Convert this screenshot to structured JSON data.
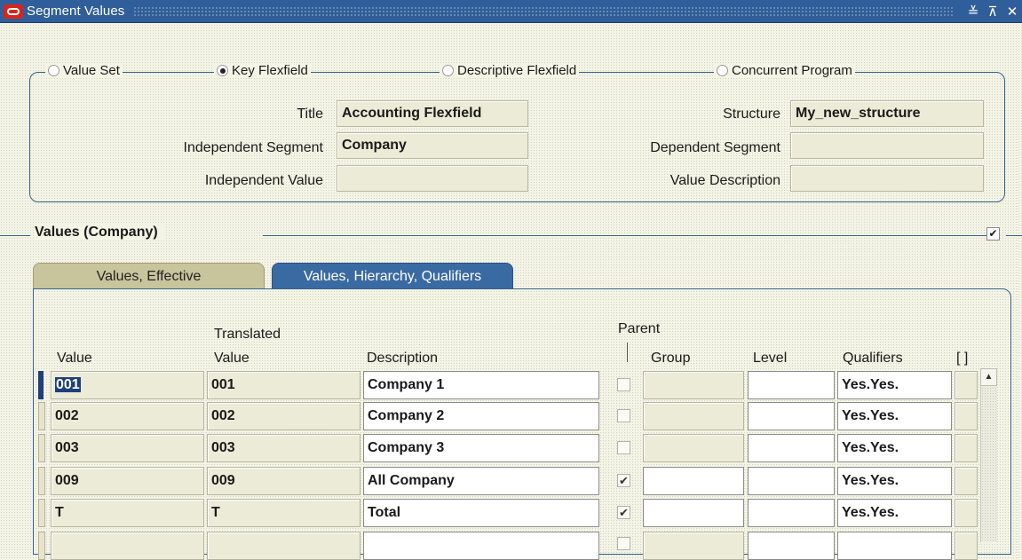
{
  "window": {
    "title": "Segment Values",
    "buttons": [
      "≚",
      "⊼",
      "✕"
    ]
  },
  "query_options": [
    {
      "label": "Value Set",
      "selected": false
    },
    {
      "label": "Key Flexfield",
      "selected": true
    },
    {
      "label": "Descriptive Flexfield",
      "selected": false
    },
    {
      "label": "Concurrent Program",
      "selected": false
    }
  ],
  "form": {
    "title_label": "Title",
    "title_value": "Accounting Flexfield",
    "structure_label": "Structure",
    "structure_value": "My_new_structure",
    "independent_segment_label": "Independent Segment",
    "independent_segment_value": "Company",
    "dependent_segment_label": "Dependent Segment",
    "dependent_segment_value": "",
    "independent_value_label": "Independent Value",
    "independent_value_value": "",
    "value_description_label": "Value Description",
    "value_description_value": ""
  },
  "section": {
    "title": "Values (Company)",
    "checked": true
  },
  "tabs": [
    {
      "label": "Values, Effective",
      "active": false
    },
    {
      "label": "Values, Hierarchy, Qualifiers",
      "active": true
    }
  ],
  "table": {
    "headers": {
      "value": "Value",
      "translated_top": "Translated",
      "translated_bottom": "Value",
      "description": "Description",
      "parent": "Parent",
      "group": "Group",
      "level": "Level",
      "qualifiers": "Qualifiers",
      "dff": "[ ]"
    },
    "rows": [
      {
        "value": "001",
        "translated": "001",
        "description": "Company 1",
        "parent": false,
        "group": "",
        "level": "",
        "qualifiers": "Yes.Yes."
      },
      {
        "value": "002",
        "translated": "002",
        "description": "Company 2",
        "parent": false,
        "group": "",
        "level": "",
        "qualifiers": "Yes.Yes."
      },
      {
        "value": "003",
        "translated": "003",
        "description": "Company 3",
        "parent": false,
        "group": "",
        "level": "",
        "qualifiers": "Yes.Yes."
      },
      {
        "value": "009",
        "translated": "009",
        "description": "All Company",
        "parent": true,
        "group": "",
        "level": "",
        "qualifiers": "Yes.Yes."
      },
      {
        "value": "T",
        "translated": "T",
        "description": "Total",
        "parent": true,
        "group": "",
        "level": "",
        "qualifiers": "Yes.Yes."
      },
      {
        "value": "",
        "translated": "",
        "description": "",
        "parent": false,
        "group": "",
        "level": "",
        "qualifiers": ""
      }
    ]
  },
  "check_mark": "✔",
  "scroll_up_glyph": "▲"
}
